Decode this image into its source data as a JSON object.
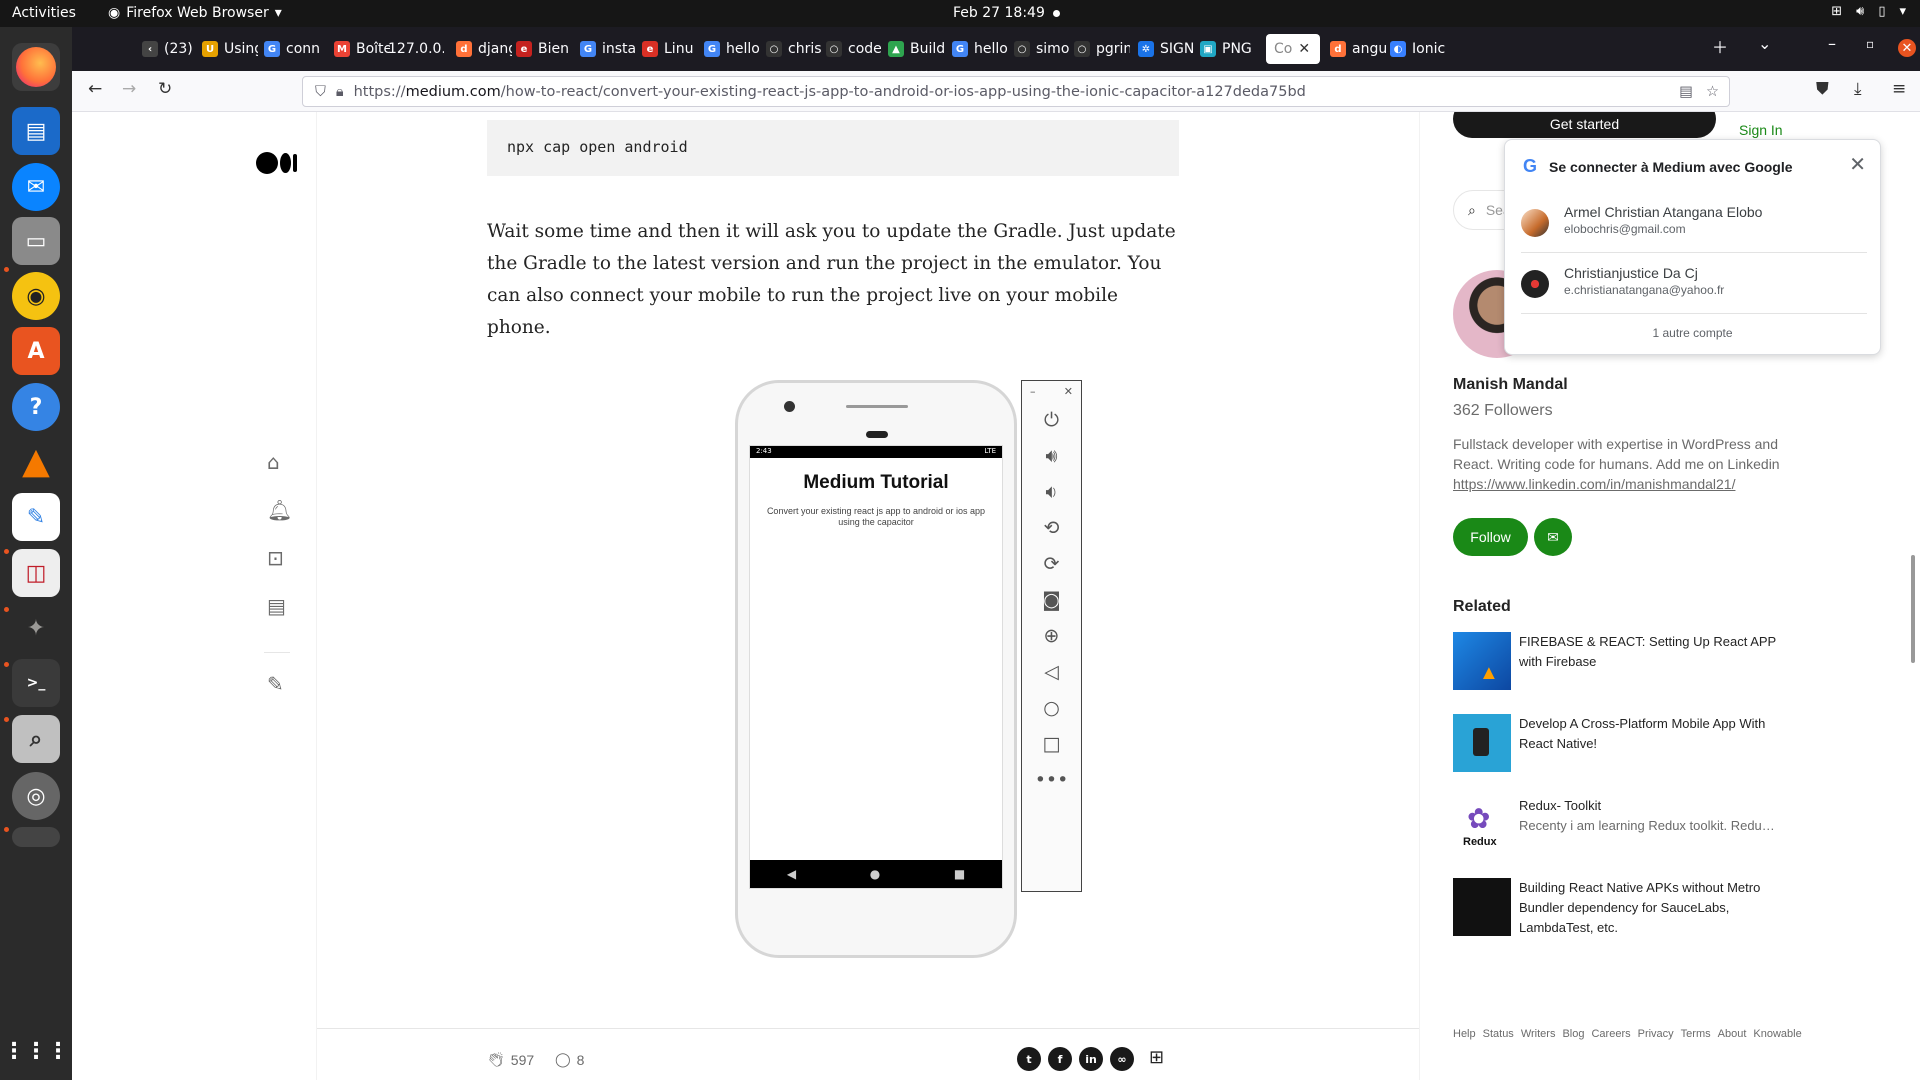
{
  "topbar": {
    "activities": "Activities",
    "app_name": "Firefox Web Browser",
    "clock": "Feb 27  18:49"
  },
  "dock": {
    "apps": [
      "firefox",
      "libreoffice-writer",
      "thunderbird",
      "files",
      "rhythmbox",
      "ubuntu-software",
      "help",
      "vlc",
      "text-editor",
      "document-viewer",
      "gimp",
      "terminal",
      "search",
      "disk",
      "drive",
      "show-apps"
    ]
  },
  "tabs": [
    {
      "label": "(23)",
      "fav": "‹"
    },
    {
      "label": "Using",
      "fav": "U"
    },
    {
      "label": "conn",
      "fav": "G"
    },
    {
      "label": "Boîte",
      "fav": "M"
    },
    {
      "label": "127.0.0.",
      "fav": ""
    },
    {
      "label": "djang",
      "fav": "d"
    },
    {
      "label": "Bien",
      "fav": "e"
    },
    {
      "label": "insta",
      "fav": "G"
    },
    {
      "label": "Linu",
      "fav": "e"
    },
    {
      "label": "hello",
      "fav": "G"
    },
    {
      "label": "chris",
      "fav": "○"
    },
    {
      "label": "code",
      "fav": "○"
    },
    {
      "label": "Build",
      "fav": "▲"
    },
    {
      "label": "hello",
      "fav": "G"
    },
    {
      "label": "simo",
      "fav": "○"
    },
    {
      "label": "pgrin",
      "fav": "○"
    },
    {
      "label": "SIGN",
      "fav": "✲"
    },
    {
      "label": "PNG",
      "fav": "▣"
    },
    {
      "label": "Co",
      "fav": ""
    },
    {
      "label": "angu",
      "fav": "d"
    },
    {
      "label": "Ionic",
      "fav": "◐"
    }
  ],
  "url": {
    "scheme": "https://",
    "host": "medium.com",
    "path": "/how-to-react/convert-your-existing-react-js-app-to-android-or-ios-app-using-the-ionic-capacitor-a127deda75bd"
  },
  "article": {
    "code": "npx cap open android",
    "paragraph": "Wait some time and then it will ask you to update the Gradle. Just update the Gradle to the latest version and run the project in the emulator. You can also connect your mobile to run the project live on your mobile phone.",
    "phone": {
      "time": "2:43",
      "network": "LTE",
      "title": "Medium Tutorial",
      "subtitle": "Convert your existing react js app to android or ios app using the capacitor"
    },
    "claps": "597",
    "comments": "8"
  },
  "sidebar": {
    "get_started": "Get started",
    "sign_in": "Sign In",
    "search_placeholder": "Search",
    "author_name": "Manish Mandal",
    "followers": "362 Followers",
    "bio": "Fullstack developer with expertise in WordPress and React. Writing code for humans. Add me on Linkedin",
    "bio_link": "https://www.linkedin.com/in/manishmandal21/",
    "follow": "Follow",
    "related_heading": "Related",
    "related": [
      {
        "title": "FIREBASE & REACT: Setting Up React APP with Firebase",
        "sub": ""
      },
      {
        "title": "Develop A Cross-Platform Mobile App With React Native!",
        "sub": ""
      },
      {
        "title": "Redux- Toolkit",
        "sub": "Recenty i am learning Redux toolkit. Redux ..."
      },
      {
        "title": "Building React Native APKs without Metro Bundler dependency for SauceLabs, LambdaTest, etc.",
        "sub": ""
      }
    ],
    "footer_links": [
      "Help",
      "Status",
      "Writers",
      "Blog",
      "Careers",
      "Privacy",
      "Terms",
      "About",
      "Knowable"
    ]
  },
  "google_popup": {
    "title": "Se connecter à Medium avec Google",
    "accounts": [
      {
        "name": "Armel Christian Atangana Elobo",
        "email": "elobochris@gmail.com"
      },
      {
        "name": "Christianjustice Da Cj",
        "email": "e.christianatangana@yahoo.fr"
      }
    ],
    "more": "1 autre compte"
  },
  "colors": {
    "medium_green": "#1a8917",
    "firefox_dark": "#1c1b22",
    "dock": "#2b2b2b"
  }
}
